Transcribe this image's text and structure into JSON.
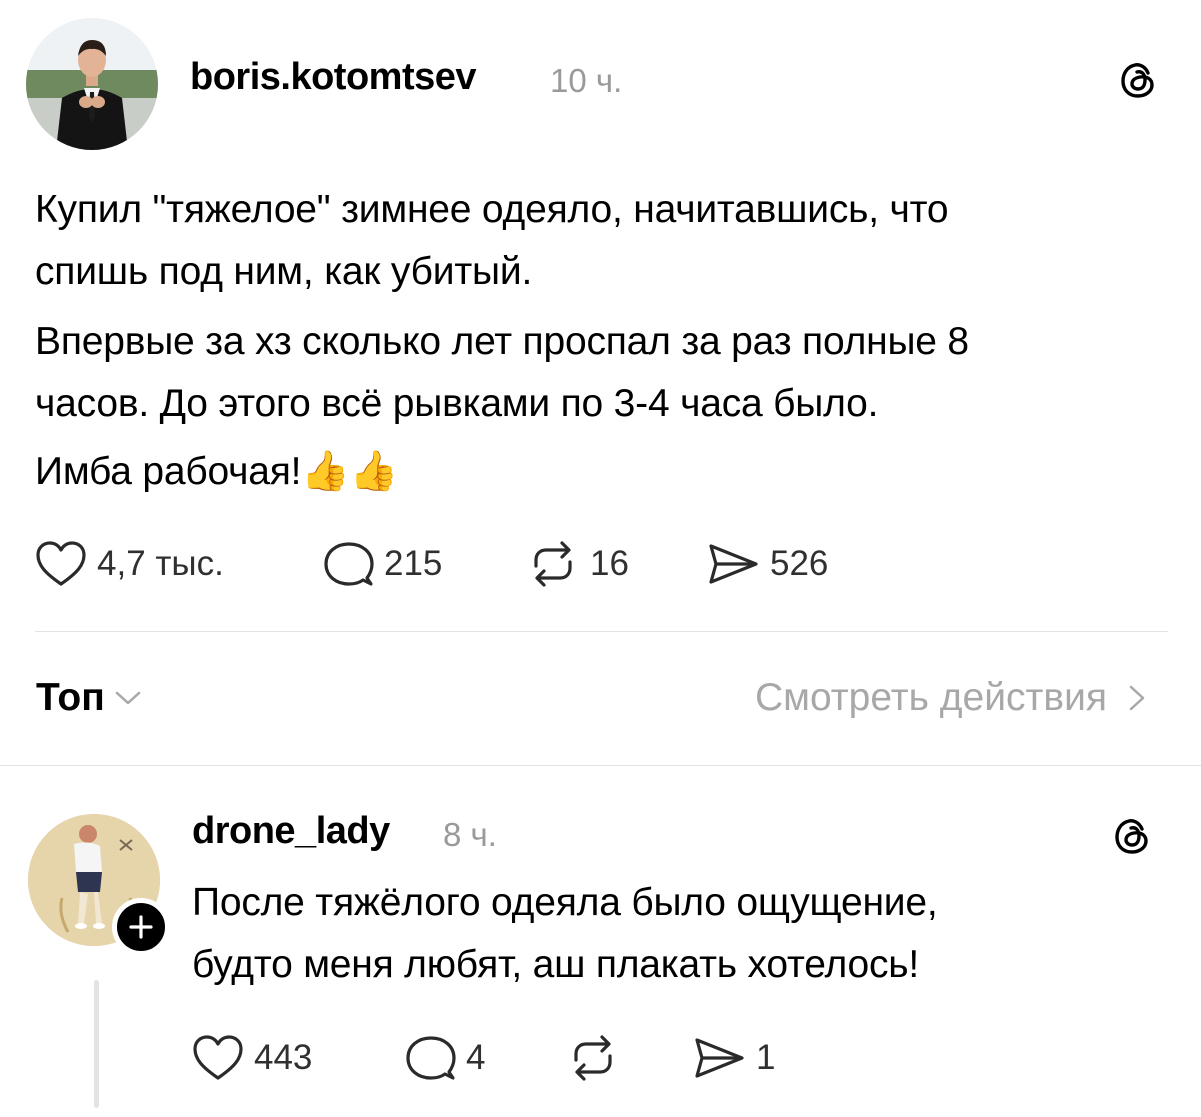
{
  "post": {
    "username": "boris.kotomtsev",
    "time": "10 ч.",
    "paragraphs": [
      "Купил \"тяжелое\" зимнее одеяло, начитавшись, что",
      "спишь под ним, как убитый.",
      "Впервые за хз сколько лет проспал за раз полные 8",
      "часов. До этого всё рывками по 3-4 часа было.",
      "Имба рабочая!"
    ],
    "emoji": "👍👍",
    "likes": "4,7 тыс.",
    "comments": "215",
    "reposts": "16",
    "shares": "526"
  },
  "sort": {
    "label": "Топ",
    "activity_label": "Смотреть действия"
  },
  "reply": {
    "username": "drone_lady",
    "time": "8 ч.",
    "lines": [
      "После тяжёлого одеяла было ощущение,",
      "будто меня любят, аш плакать хотелось!"
    ],
    "likes": "443",
    "comments": "4",
    "shares": "1"
  },
  "icons": {
    "threads": "threads-logo-icon",
    "like": "heart-icon",
    "comment": "comment-bubble-icon",
    "repost": "repost-arrows-icon",
    "share": "paper-plane-icon",
    "follow": "plus-icon"
  }
}
